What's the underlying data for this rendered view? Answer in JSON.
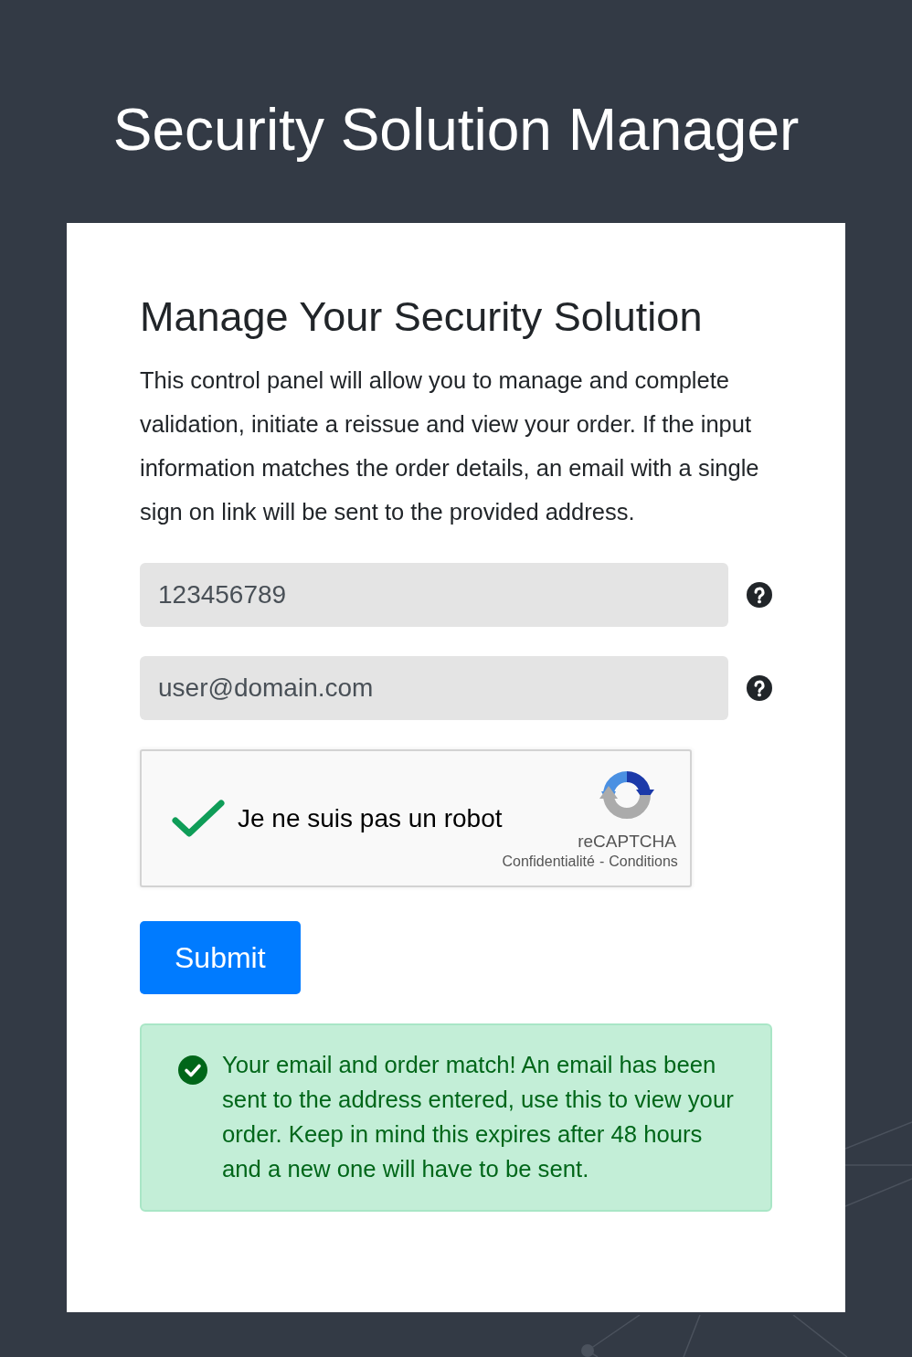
{
  "header": {
    "title": "Security Solution Manager"
  },
  "panel": {
    "heading": "Manage Your Security Solution",
    "description": "This control panel will allow you to manage and complete validation, initiate a reissue and view your order. If the input information matches the order details, an email with a single sign on link will be sent to the provided address.",
    "fields": [
      {
        "value": "123456789"
      },
      {
        "value": "user@domain.com"
      }
    ],
    "captcha": {
      "label": "Je ne suis pas un robot",
      "checked": true,
      "brand": "reCAPTCHA",
      "links": [
        "Confidentialité",
        "Conditions"
      ],
      "separator": "-"
    },
    "submit": {
      "label": "Submit"
    },
    "alert": {
      "kind": "success",
      "message": "Your email and order match! An email has been sent to the address entered, use this to view your order. Keep in mind this expires after 48 hours and a new one will have to be sent."
    }
  }
}
